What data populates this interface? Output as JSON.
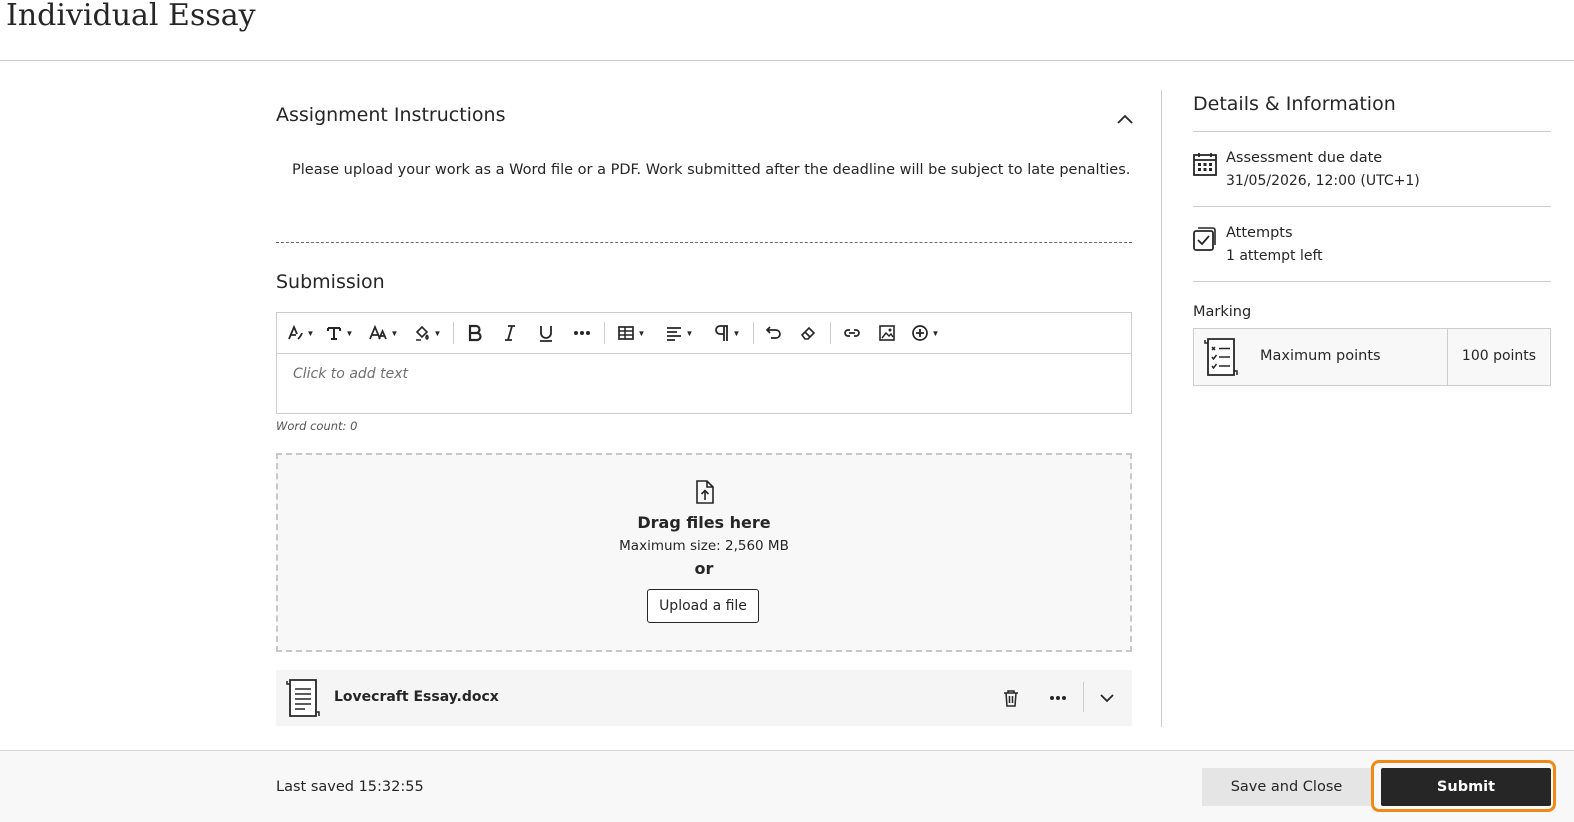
{
  "page": {
    "title": "Individual Essay"
  },
  "instructions": {
    "heading": "Assignment Instructions",
    "text": "Please upload your work as a Word file or a PDF. Work submitted after the deadline will be subject to late penalties."
  },
  "submission": {
    "heading": "Submission",
    "editor_placeholder": "Click to add text",
    "word_count": "Word count: 0",
    "toolbar_icons": [
      "text-style-icon",
      "paragraph-style-icon",
      "font-size-icon",
      "highlight-icon",
      "bold-icon",
      "italic-icon",
      "underline-icon",
      "more-icon",
      "table-icon",
      "align-icon",
      "paragraph-icon",
      "undo-icon",
      "clear-format-icon",
      "link-icon",
      "image-icon",
      "insert-icon"
    ]
  },
  "dropzone": {
    "title": "Drag files here",
    "max_size": "Maximum size: 2,560 MB",
    "or": "or",
    "upload_label": "Upload a file"
  },
  "file": {
    "name": "Lovecraft Essay.docx"
  },
  "details": {
    "heading": "Details & Information",
    "due_label": "Assessment due date",
    "due_value": "31/05/2026, 12:00 (UTC+1)",
    "attempts_label": "Attempts",
    "attempts_value": "1 attempt left",
    "marking_label": "Marking",
    "max_points_label": "Maximum points",
    "max_points_value": "100 points"
  },
  "footer": {
    "last_saved": "Last saved 15:32:55",
    "save_close_label": "Save and Close",
    "submit_label": "Submit"
  },
  "colors": {
    "accent_ring": "#f08a16",
    "submit_bg": "#262626"
  }
}
